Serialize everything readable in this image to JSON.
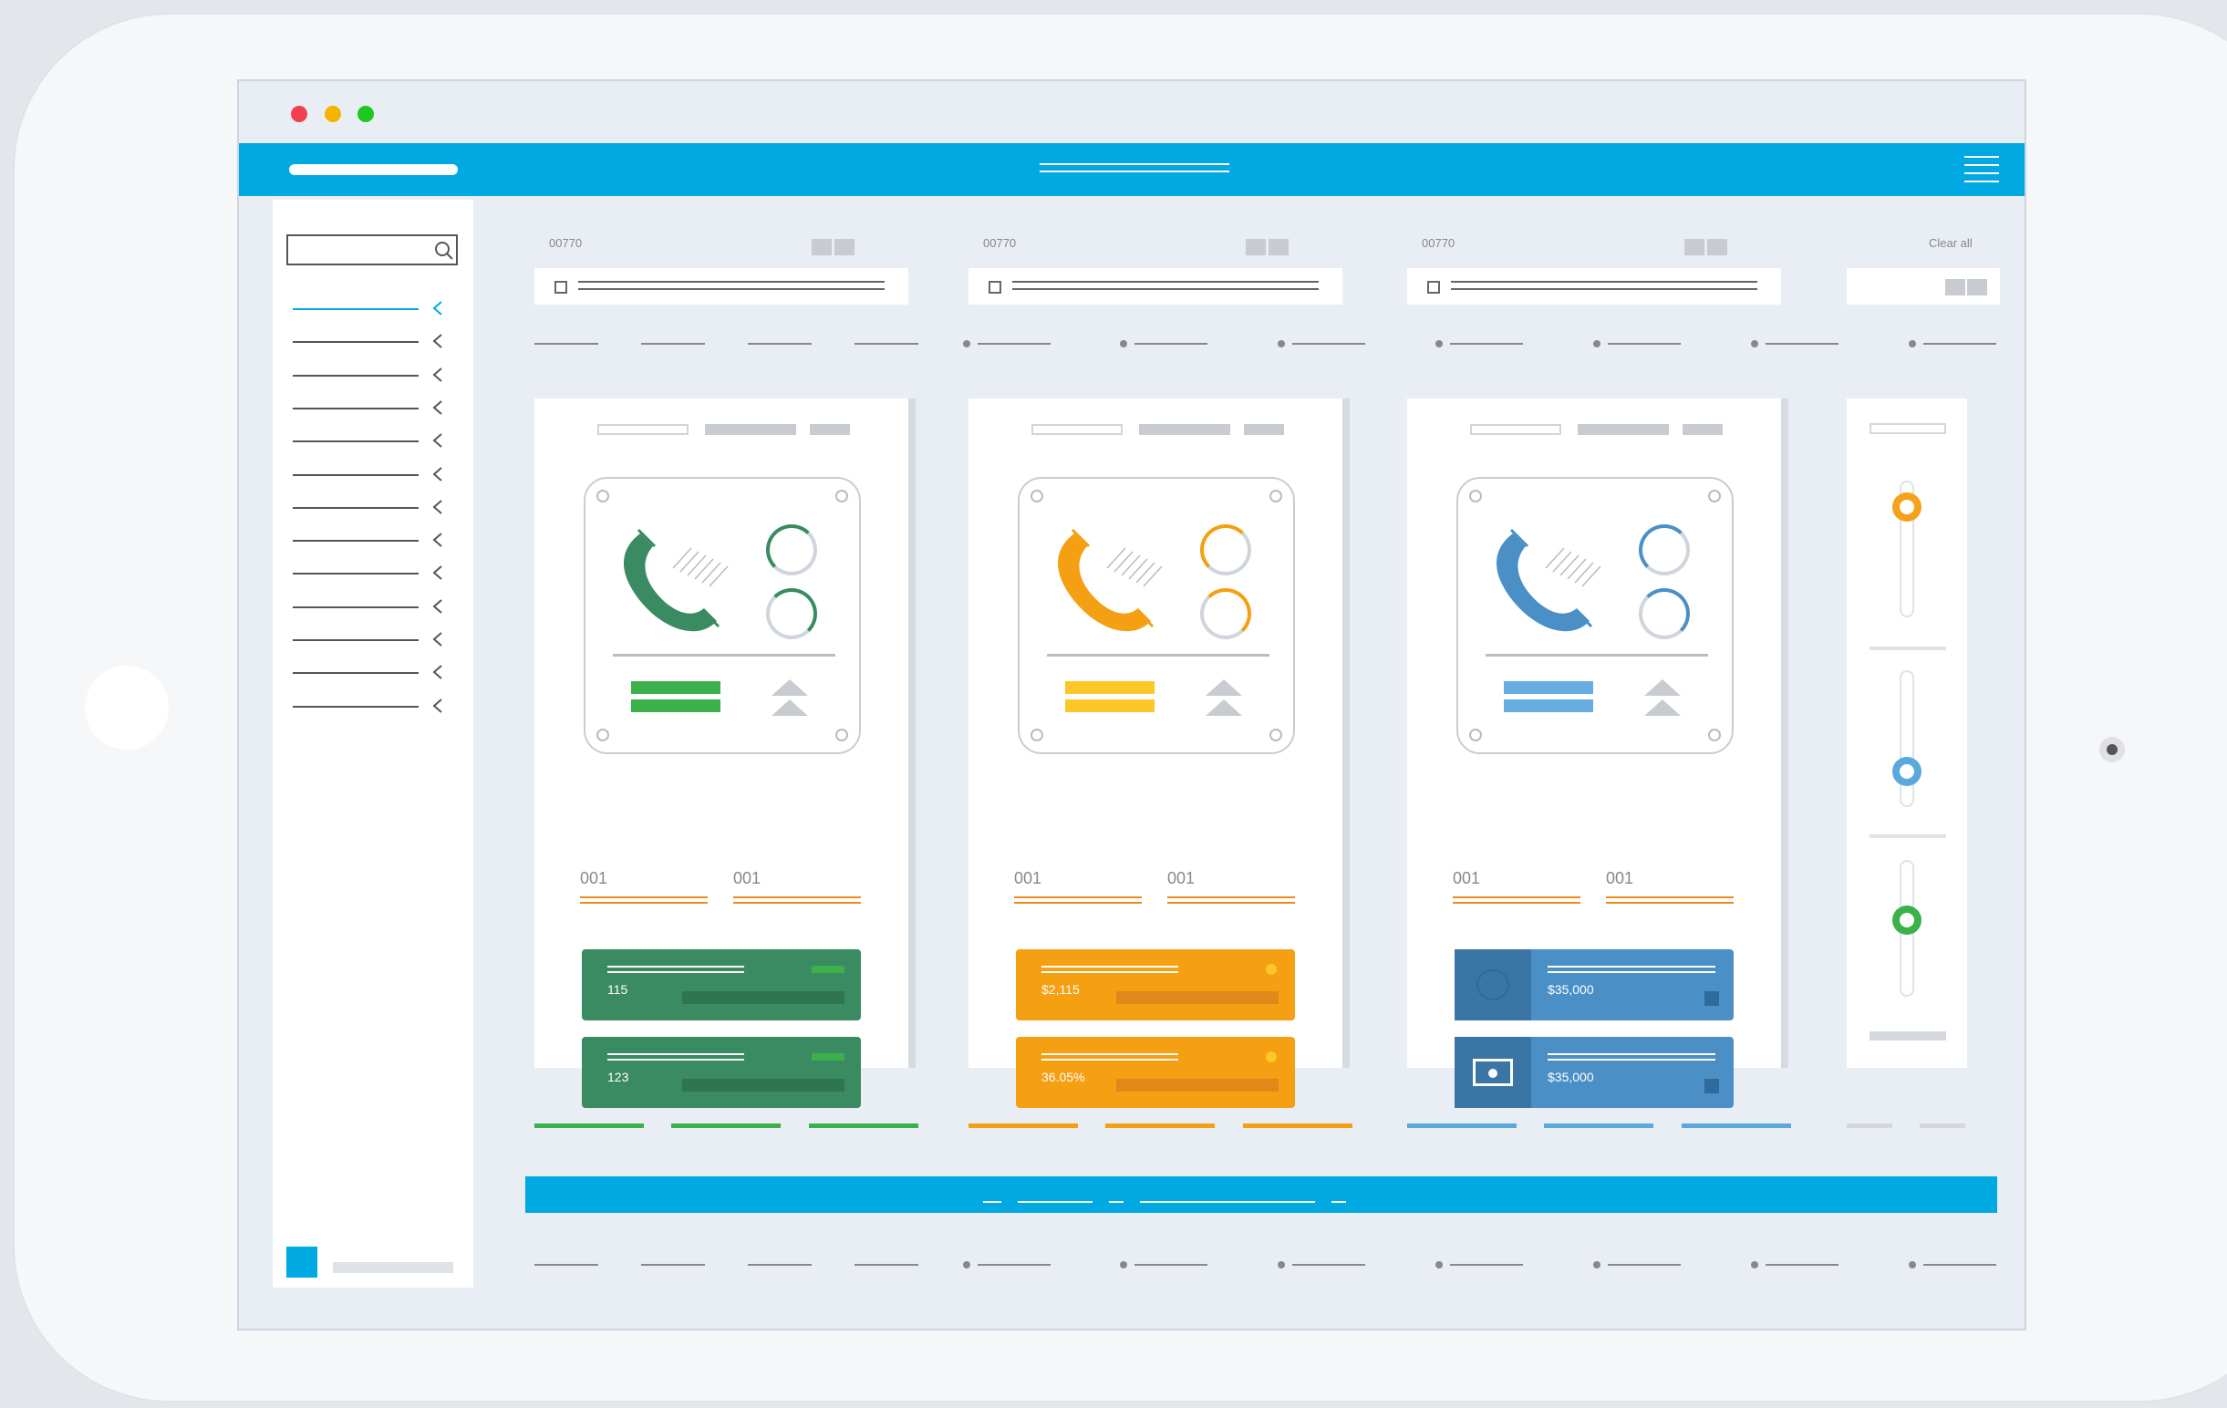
{
  "window_controls": {
    "close_color": "#f2404e",
    "minimize_color": "#f5b400",
    "maximize_color": "#1ec81e"
  },
  "colors": {
    "topbar": "#00a9e2",
    "green": "#3a8a62",
    "orange": "#f59f12",
    "blue": "#4a8fc5",
    "line_orange": "#f08a1c"
  },
  "header": {
    "menu_icon": "hamburger-icon",
    "logo_placeholder": "logo-bar"
  },
  "sidebar": {
    "search": {
      "value": "",
      "icon": "search-icon"
    },
    "item_count": 13,
    "active_index": 0
  },
  "filters": [
    {
      "code": "00770"
    },
    {
      "code": "00770"
    },
    {
      "code": "00770"
    }
  ],
  "clear_all_label": "Clear all",
  "columns": [
    {
      "accent": "green",
      "icon": "phone-icon",
      "field_a": "001",
      "field_b": "001",
      "cards": [
        {
          "value": "115"
        },
        {
          "value": "123"
        }
      ]
    },
    {
      "accent": "orange",
      "icon": "phone-icon",
      "field_a": "001",
      "field_b": "001",
      "cards": [
        {
          "value": "$2,115"
        },
        {
          "value": "36.05%"
        }
      ]
    },
    {
      "accent": "blue",
      "icon": "phone-icon",
      "field_a": "001",
      "field_b": "001",
      "cards": [
        {
          "value": "$35,000"
        },
        {
          "value": "$35,000"
        }
      ]
    }
  ],
  "sliders": [
    {
      "color": "#f5a21b",
      "level": 0.9
    },
    {
      "color": "#5aa9dd",
      "level": 0.25
    },
    {
      "color": "#3cb04a",
      "level": 0.6
    }
  ]
}
